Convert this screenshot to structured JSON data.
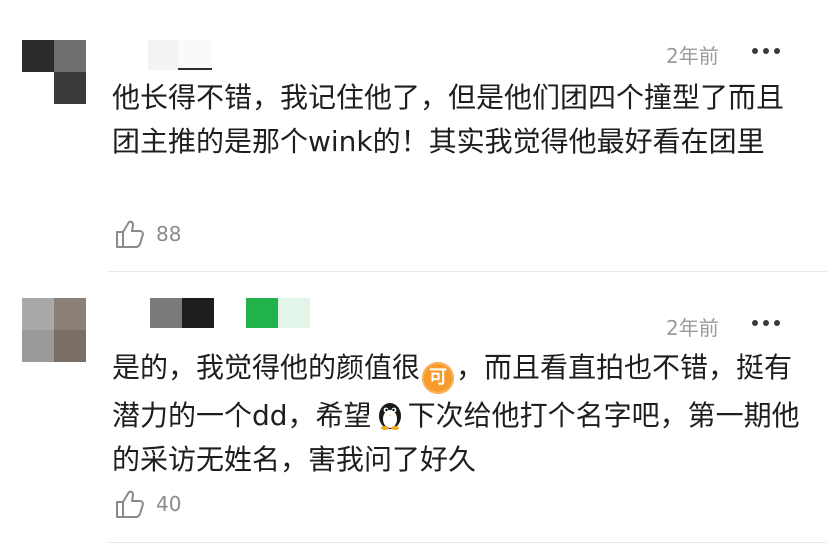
{
  "comments": [
    {
      "time": "2年前",
      "text": "他长得不错，我记住他了，但是他们团四个撞型了而且团主推的是那个wink的！其实我觉得他最好看在团里",
      "likes": "88",
      "avatar_colors": [
        "#2b2b2b",
        "#6e6e6e",
        "#ffffff",
        "#3a3a3a"
      ],
      "name_colors": [
        "#f3f3f3",
        "#ffffff",
        "#e6e6e6"
      ]
    },
    {
      "time": "2年前",
      "text_before_ke": "是的，我觉得他的颜值很",
      "emoji_ke": "可",
      "text_after_ke": "，而且看直拍也不错，挺有潜力的一个dd，希望",
      "text_after_penguin": "下次给他打个名字吧，第一期他的采访无姓名，害我问了好久",
      "likes": "40",
      "avatar_colors": [
        "#a9a9a9",
        "#8a8078",
        "#9a9a9a",
        "#7a6e66"
      ],
      "name_colors": [
        "#7a7a7a",
        "#1e1e1e",
        "#ffffff",
        "#22b24c",
        "#e3f5e8"
      ]
    }
  ]
}
